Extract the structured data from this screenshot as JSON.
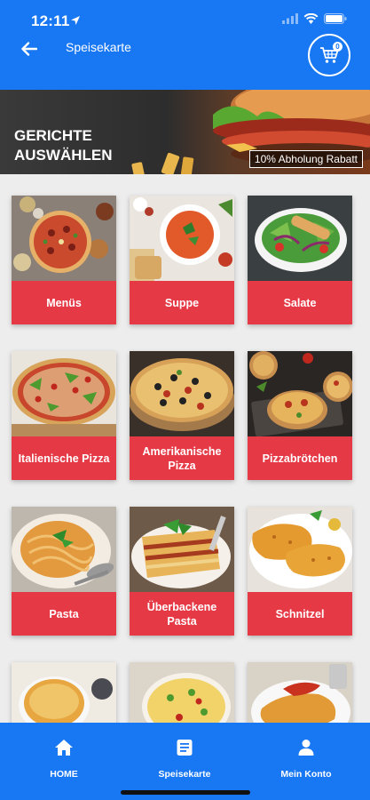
{
  "status_bar": {
    "time": "12:11"
  },
  "header": {
    "title": "Speisekarte",
    "cart_count": "0"
  },
  "banner": {
    "title": "GERICHTE AUSWÄHLEN",
    "promo": "10% Abholung Rabatt"
  },
  "categories": [
    {
      "label": "Menüs",
      "image": "pizza-platter"
    },
    {
      "label": "Suppe",
      "image": "tomato-soup"
    },
    {
      "label": "Salate",
      "image": "salad-bowl"
    },
    {
      "label": "Italienische Pizza",
      "image": "italian-pizza"
    },
    {
      "label": "Amerikanische Pizza",
      "image": "american-pizza"
    },
    {
      "label": "Pizzabrötchen",
      "image": "pizza-rolls"
    },
    {
      "label": "Pasta",
      "image": "spaghetti"
    },
    {
      "label": "Überbackene Pasta",
      "image": "lasagna"
    },
    {
      "label": "Schnitzel",
      "image": "schnitzel"
    },
    {
      "label": "",
      "image": "casserole"
    },
    {
      "label": "",
      "image": "omelette"
    },
    {
      "label": "",
      "image": "cordon-bleu"
    }
  ],
  "bottom_nav": [
    {
      "label": "HOME",
      "icon": "home-icon"
    },
    {
      "label": "Speisekarte",
      "icon": "menu-book-icon"
    },
    {
      "label": "Mein Konto",
      "icon": "account-icon"
    }
  ],
  "colors": {
    "primary": "#1877f2",
    "accent": "#e63946",
    "background": "#ededed"
  }
}
